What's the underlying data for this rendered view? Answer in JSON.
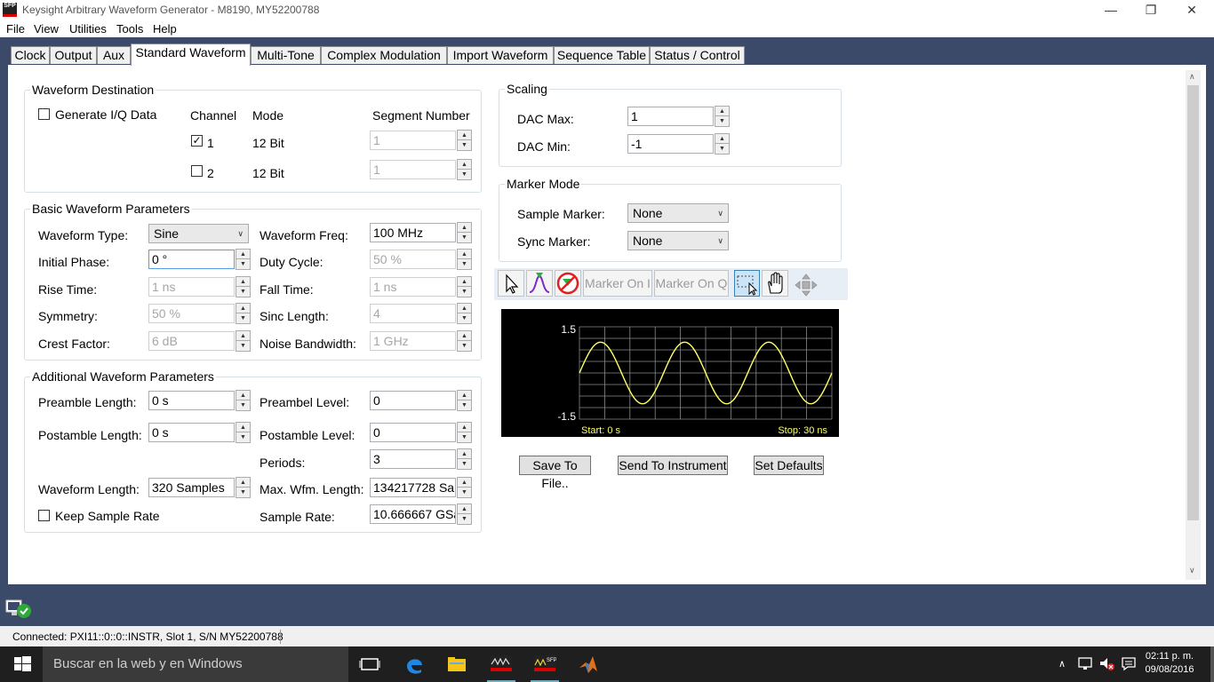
{
  "window": {
    "title": "Keysight Arbitrary Waveform Generator - M8190, MY52200788",
    "app_icon_text": "SFP"
  },
  "menu": [
    "File",
    "View",
    "Utilities",
    "Tools",
    "Help"
  ],
  "tabs": [
    {
      "label": "Clock",
      "active": false
    },
    {
      "label": "Output",
      "active": false
    },
    {
      "label": "Aux",
      "active": false
    },
    {
      "label": "Standard Waveform",
      "active": true
    },
    {
      "label": "Multi-Tone",
      "active": false
    },
    {
      "label": "Complex Modulation",
      "active": false
    },
    {
      "label": "Import Waveform",
      "active": false
    },
    {
      "label": "Sequence Table",
      "active": false
    },
    {
      "label": "Status / Control",
      "active": false
    }
  ],
  "destination": {
    "title": "Waveform Destination",
    "generate_iq": "Generate I/Q Data",
    "generate_iq_checked": false,
    "col_channel": "Channel",
    "col_mode": "Mode",
    "col_segment": "Segment Number",
    "channels": [
      {
        "num": "1",
        "checked": true,
        "mode": "12 Bit",
        "segment": "1"
      },
      {
        "num": "2",
        "checked": false,
        "mode": "12 Bit",
        "segment": "1"
      }
    ]
  },
  "basic": {
    "title": "Basic Waveform Parameters",
    "waveform_type_label": "Waveform Type:",
    "waveform_type": "Sine",
    "initial_phase_label": "Initial Phase:",
    "initial_phase": "0 °",
    "rise_time_label": "Rise Time:",
    "rise_time": "1 ns",
    "symmetry_label": "Symmetry:",
    "symmetry": "50 %",
    "crest_factor_label": "Crest Factor:",
    "crest_factor": "6 dB",
    "waveform_freq_label": "Waveform Freq:",
    "waveform_freq": "100 MHz",
    "duty_cycle_label": "Duty Cycle:",
    "duty_cycle": "50 %",
    "fall_time_label": "Fall Time:",
    "fall_time": "1 ns",
    "sinc_length_label": "Sinc Length:",
    "sinc_length": "4",
    "noise_bw_label": "Noise Bandwidth:",
    "noise_bw": "1 GHz"
  },
  "additional": {
    "title": "Additional Waveform Parameters",
    "preamble_length_label": "Preamble Length:",
    "preamble_length": "0 s",
    "postamble_length_label": "Postamble Length:",
    "postamble_length": "0 s",
    "preambel_level_label": "Preambel Level:",
    "preambel_level": "0",
    "postamble_level_label": "Postamble Level:",
    "postamble_level": "0",
    "periods_label": "Periods:",
    "periods": "3",
    "waveform_length_label": "Waveform Length:",
    "waveform_length": "320 Samples",
    "max_wfm_length_label": "Max. Wfm. Length:",
    "max_wfm_length": "134217728 San",
    "keep_sample_rate": "Keep Sample Rate",
    "keep_sample_rate_checked": false,
    "sample_rate_label": "Sample Rate:",
    "sample_rate": "10.666667 GSa/"
  },
  "scaling": {
    "title": "Scaling",
    "dac_max_label": "DAC Max:",
    "dac_max": "1",
    "dac_min_label": "DAC Min:",
    "dac_min": "-1"
  },
  "marker": {
    "title": "Marker Mode",
    "sample_marker_label": "Sample Marker:",
    "sample_marker": "None",
    "sync_marker_label": "Sync Marker:",
    "sync_marker": "None"
  },
  "toolbar": {
    "marker_on_i": "Marker On I",
    "marker_on_q": "Marker On Q"
  },
  "chart_data": {
    "type": "line",
    "y_top_label": "1.5",
    "y_bottom_label": "-1.5",
    "ylim": [
      -1.5,
      1.5
    ],
    "start_label": "Start: 0  s",
    "stop_label": "Stop: 30 ns",
    "xlim": [
      0,
      30
    ],
    "periods": 3,
    "amplitude": 1,
    "series_color": "#ffff66",
    "grid": true
  },
  "buttons": {
    "save": "Save To File..",
    "send": "Send To Instrument",
    "defaults": "Set Defaults"
  },
  "status": {
    "connection": "Connected: PXI11::0::0::INSTR, Slot 1, S/N MY52200788"
  },
  "taskbar": {
    "search_placeholder": "Buscar en la web y en Windows",
    "time": "02:11 p. m.",
    "date": "09/08/2016"
  }
}
